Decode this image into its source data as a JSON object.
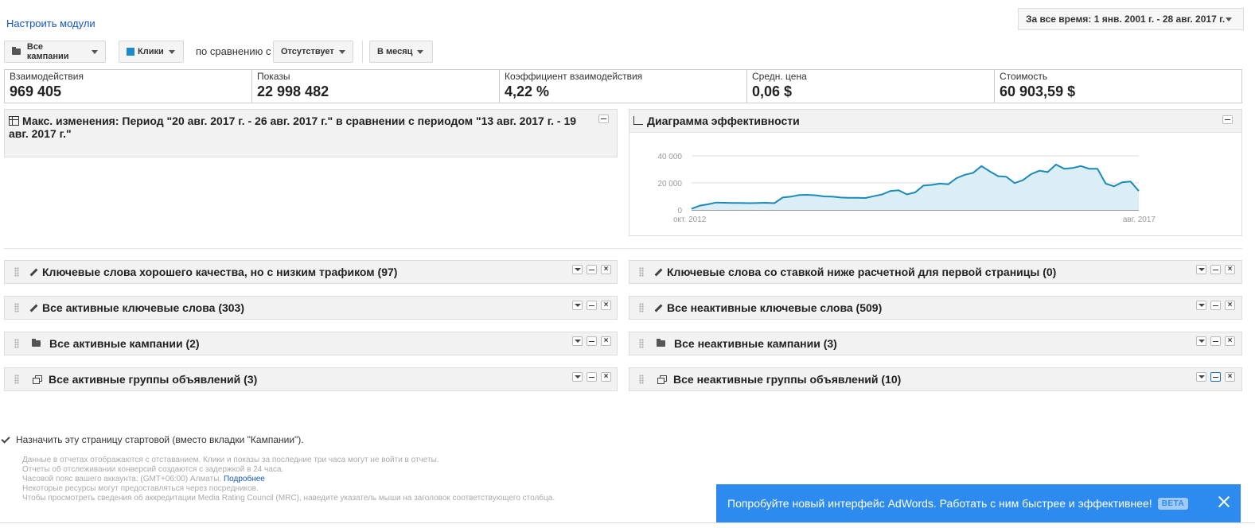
{
  "header": {
    "customize_link": "Настроить модули",
    "date_range": "За все время: 1 янв. 2001 г. - 28 авг. 2017 г."
  },
  "toolbar": {
    "campaigns_label": "Все кампании",
    "metric_label": "Клики",
    "metric_color": "#1e88c8",
    "compare_label": "по сравнению с",
    "compare_value": "Отсутствует",
    "period_label": "В месяц"
  },
  "metrics": [
    {
      "label": "Взаимодействия",
      "value": "969 405"
    },
    {
      "label": "Показы",
      "value": "22 998 482"
    },
    {
      "label": "Коэффициент взаимодействия",
      "value": "4,22 %"
    },
    {
      "label": "Средн. цена",
      "value": "0,06 $"
    },
    {
      "label": "Стоимость",
      "value": "60 903,59 $"
    }
  ],
  "max_changes": {
    "title": "Макс. изменения:  Период \"20 авг. 2017 г. - 26 авг. 2017 г.\" в сравнении с периодом \"13 авг. 2017 г. - 19 авг. 2017 г.\""
  },
  "performance": {
    "title": "Диаграмма эффективности",
    "chart_data": {
      "type": "area",
      "title": "",
      "y_ticks": [
        "40 000",
        "20 000",
        "0"
      ],
      "x_tick_labels": [
        "окт. 2012",
        "авг. 2017"
      ],
      "ylim": [
        0,
        40000
      ],
      "color": "#1a8bb8",
      "values": [
        800,
        3200,
        4200,
        5500,
        5300,
        5200,
        5100,
        5000,
        5200,
        5300,
        5000,
        9200,
        9800,
        11000,
        11200,
        10800,
        10000,
        9800,
        9200,
        9000,
        9000,
        8800,
        10200,
        11500,
        14000,
        14500,
        11500,
        13000,
        18000,
        18500,
        19500,
        19000,
        23500,
        26000,
        27500,
        32500,
        28500,
        25000,
        24500,
        19800,
        22000,
        26500,
        29000,
        28000,
        33500,
        30500,
        31000,
        32500,
        30500,
        30500,
        19500,
        17500,
        20500,
        21000,
        14000
      ]
    }
  },
  "widgets_left": [
    {
      "title": "Ключевые слова хорошего качества, но с низким трафиком (97)",
      "icon": "pencil-icon"
    },
    {
      "title": "Все активные ключевые слова (303)",
      "icon": "pencil-icon"
    },
    {
      "title": "Все активные кампании (2)",
      "icon": "folder-icon"
    },
    {
      "title": "Все активные группы объявлений (3)",
      "icon": "ad-group-icon"
    }
  ],
  "widgets_right": [
    {
      "title": "Ключевые слова со ставкой ниже расчетной для первой страницы (0)",
      "icon": "pencil-icon"
    },
    {
      "title": "Все неактивные ключевые слова (509)",
      "icon": "pencil-icon"
    },
    {
      "title": "Все неактивные кампании (3)",
      "icon": "folder-icon"
    },
    {
      "title": "Все неактивные группы объявлений (10)",
      "icon": "ad-group-icon"
    }
  ],
  "footer": {
    "start_page_label": "Назначить эту страницу стартовой (вместо вкладки \"Кампании\").",
    "note_1": "Данные в отчетах отображаются с отставанием. Клики и показы за последние три часа могут не войти в отчеты.",
    "note_2": "Отчеты об отслеживании конверсий создаются с задержкой в 24 часа.",
    "note_3": "Часовой пояс вашего аккаунта: (GMT+06:00) Алматы.",
    "note_3_link": "Подробнее",
    "note_4": "Некоторые ресурсы могут предоставляться через посредников.",
    "note_5": "Чтобы просмотреть сведения об аккредитации Media Rating Council (MRC), наведите указатель мыши на заголовок соответствующего столбца."
  },
  "banner": {
    "text": "Попробуйте новый интерфейс AdWords. Работать с ним быстрее и эффективнее!",
    "badge": "BETA",
    "color": "#2d8bf0"
  }
}
